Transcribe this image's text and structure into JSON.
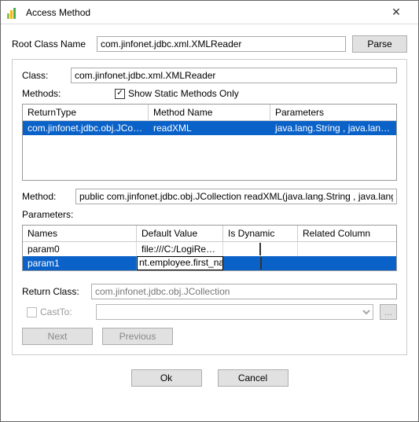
{
  "window": {
    "title": "Access Method"
  },
  "root": {
    "label": "Root Class Name",
    "value": "com.jinfonet.jdbc.xml.XMLReader",
    "parse_label": "Parse"
  },
  "panel": {
    "class_label": "Class:",
    "class_value": "com.jinfonet.jdbc.xml.XMLReader",
    "methods_label": "Methods:",
    "show_static_label": "Show Static Methods Only",
    "show_static_checked": true,
    "methods_table": {
      "headers": [
        "ReturnType",
        "Method Name",
        "Parameters"
      ],
      "row": {
        "returnType": "com.jinfonet.jdbc.obj.JCollec...",
        "methodName": "readXML",
        "parameters": "java.lang.String , java.lang.S..."
      }
    },
    "method_label": "Method:",
    "method_value": "public com.jinfonet.jdbc.obj.JCollection readXML(java.lang.String , java.lang.String )",
    "params_label": "Parameters:",
    "params_table": {
      "headers": [
        "Names",
        "Default Value",
        "Is Dynamic",
        "Related Column"
      ],
      "rows": [
        {
          "name": "param0",
          "defaultValue": "file:///C:/LogiReport...",
          "isDynamic": false,
          "relatedColumn": "",
          "selected": false,
          "editing": false
        },
        {
          "name": "param1",
          "defaultValue": "nt.employee.first_name",
          "isDynamic": false,
          "relatedColumn": "",
          "selected": true,
          "editing": true
        }
      ]
    },
    "return_class_label": "Return Class:",
    "return_class_value": "com.jinfonet.jdbc.obj.JCollection",
    "castto_label": "CastTo:",
    "castto_value": "",
    "next_label": "Next",
    "previous_label": "Previous"
  },
  "footer": {
    "ok": "Ok",
    "cancel": "Cancel"
  }
}
